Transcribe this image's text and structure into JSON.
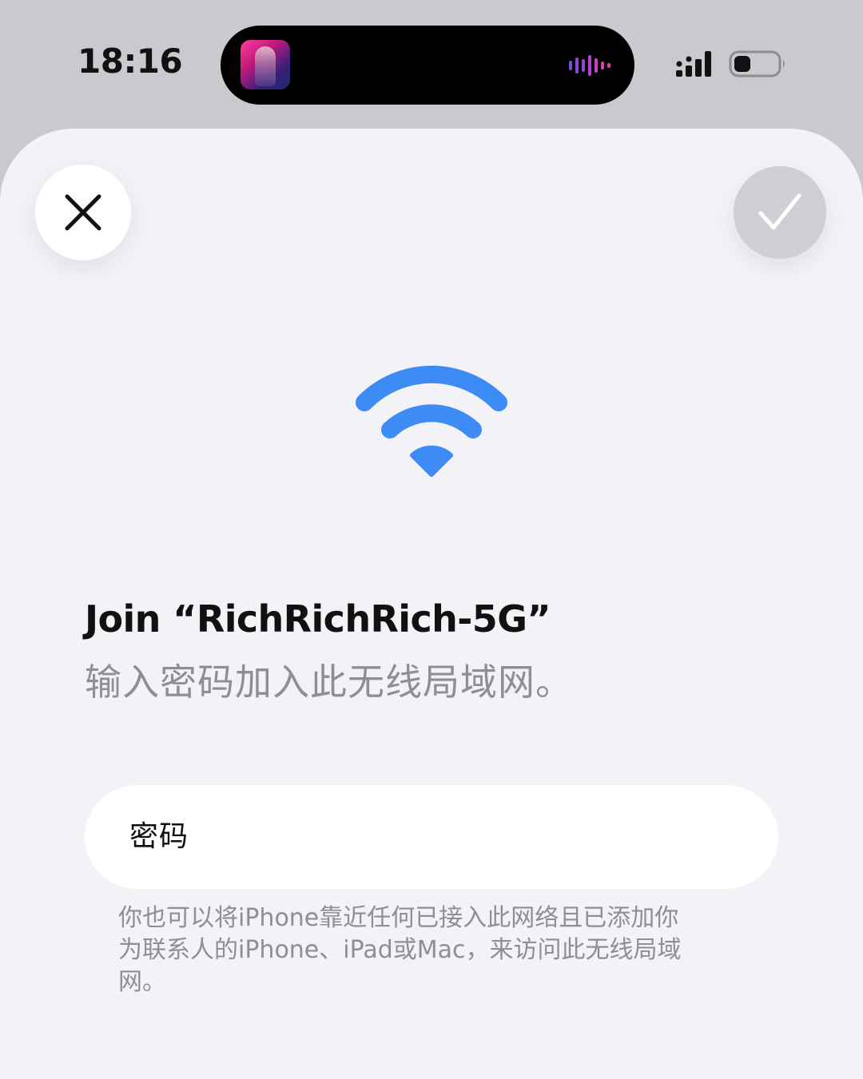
{
  "status_bar": {
    "time": "18:16",
    "live_activity": "music-playback",
    "signal_icon": "cellular-signal-icon",
    "battery_icon": "battery-low-icon"
  },
  "sheet": {
    "close_icon": "close-x-icon",
    "confirm_icon": "checkmark-icon",
    "confirm_enabled": false,
    "network_icon": "wifi-icon",
    "title": "Join “RichRichRich-5G”",
    "subtitle": "输入密码加入此无线局域网。",
    "password_field": {
      "label": "密码",
      "value": ""
    },
    "hint": "你也可以将iPhone靠近任何已接入此网络且已添加你为联系人的iPhone、iPad或Mac，来访问此无线局域网。"
  },
  "colors": {
    "accent_blue": "#3d8bf5",
    "sheet_background": "#f2f2f7",
    "secondary_text": "#8e8e93"
  }
}
